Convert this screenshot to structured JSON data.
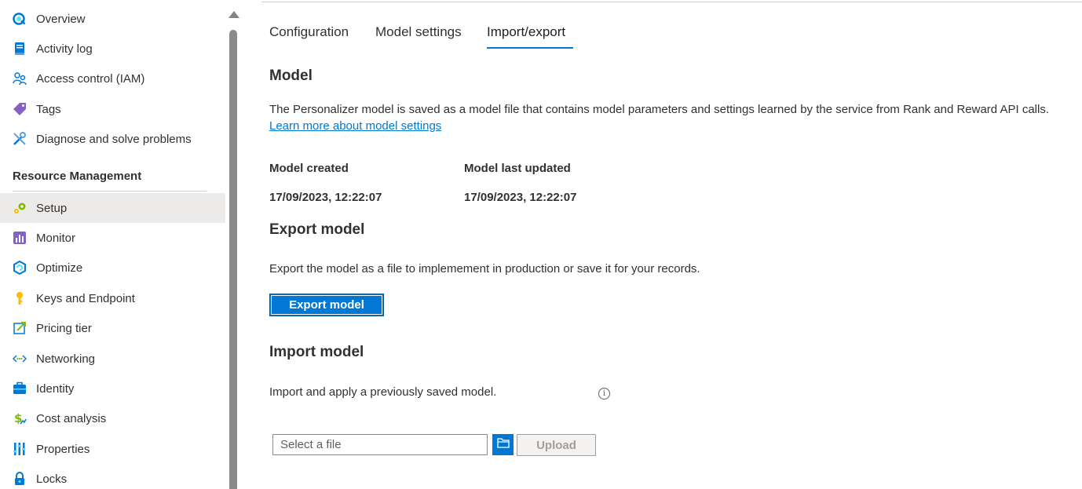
{
  "sidebar": {
    "items_top": [
      {
        "label": "Overview",
        "icon": "overview-icon"
      },
      {
        "label": "Activity log",
        "icon": "activity-log-icon"
      },
      {
        "label": "Access control (IAM)",
        "icon": "access-control-icon"
      },
      {
        "label": "Tags",
        "icon": "tag-icon"
      },
      {
        "label": "Diagnose and solve problems",
        "icon": "diagnose-icon"
      }
    ],
    "section_header": "Resource Management",
    "items_resource": [
      {
        "label": "Setup",
        "icon": "setup-icon"
      },
      {
        "label": "Monitor",
        "icon": "monitor-icon"
      },
      {
        "label": "Optimize",
        "icon": "optimize-icon"
      },
      {
        "label": "Keys and Endpoint",
        "icon": "key-icon"
      },
      {
        "label": "Pricing tier",
        "icon": "pricing-tier-icon"
      },
      {
        "label": "Networking",
        "icon": "networking-icon"
      },
      {
        "label": "Identity",
        "icon": "identity-icon"
      },
      {
        "label": "Cost analysis",
        "icon": "cost-analysis-icon"
      },
      {
        "label": "Properties",
        "icon": "properties-icon"
      },
      {
        "label": "Locks",
        "icon": "lock-icon"
      }
    ],
    "selected": "Setup"
  },
  "tabs": [
    {
      "label": "Configuration"
    },
    {
      "label": "Model settings"
    },
    {
      "label": "Import/export"
    }
  ],
  "active_tab": "Import/export",
  "model": {
    "heading": "Model",
    "description": "The Personalizer model is saved as a model file that contains model parameters and settings learned by the service from Rank and Reward API calls.",
    "learn_more": "Learn more about model settings",
    "created_label": "Model created",
    "created_value": "17/09/2023, 12:22:07",
    "updated_label": "Model last updated",
    "updated_value": "17/09/2023, 12:22:07"
  },
  "export": {
    "heading": "Export model",
    "description": "Export the model as a file to implemement in production or save it for your records.",
    "button": "Export model"
  },
  "import": {
    "heading": "Import model",
    "description": "Import and apply a previously saved model.",
    "file_placeholder": "Select a file",
    "upload_button": "Upload"
  },
  "colors": {
    "accent": "#0078d4",
    "selected_bg": "#edebe9"
  }
}
